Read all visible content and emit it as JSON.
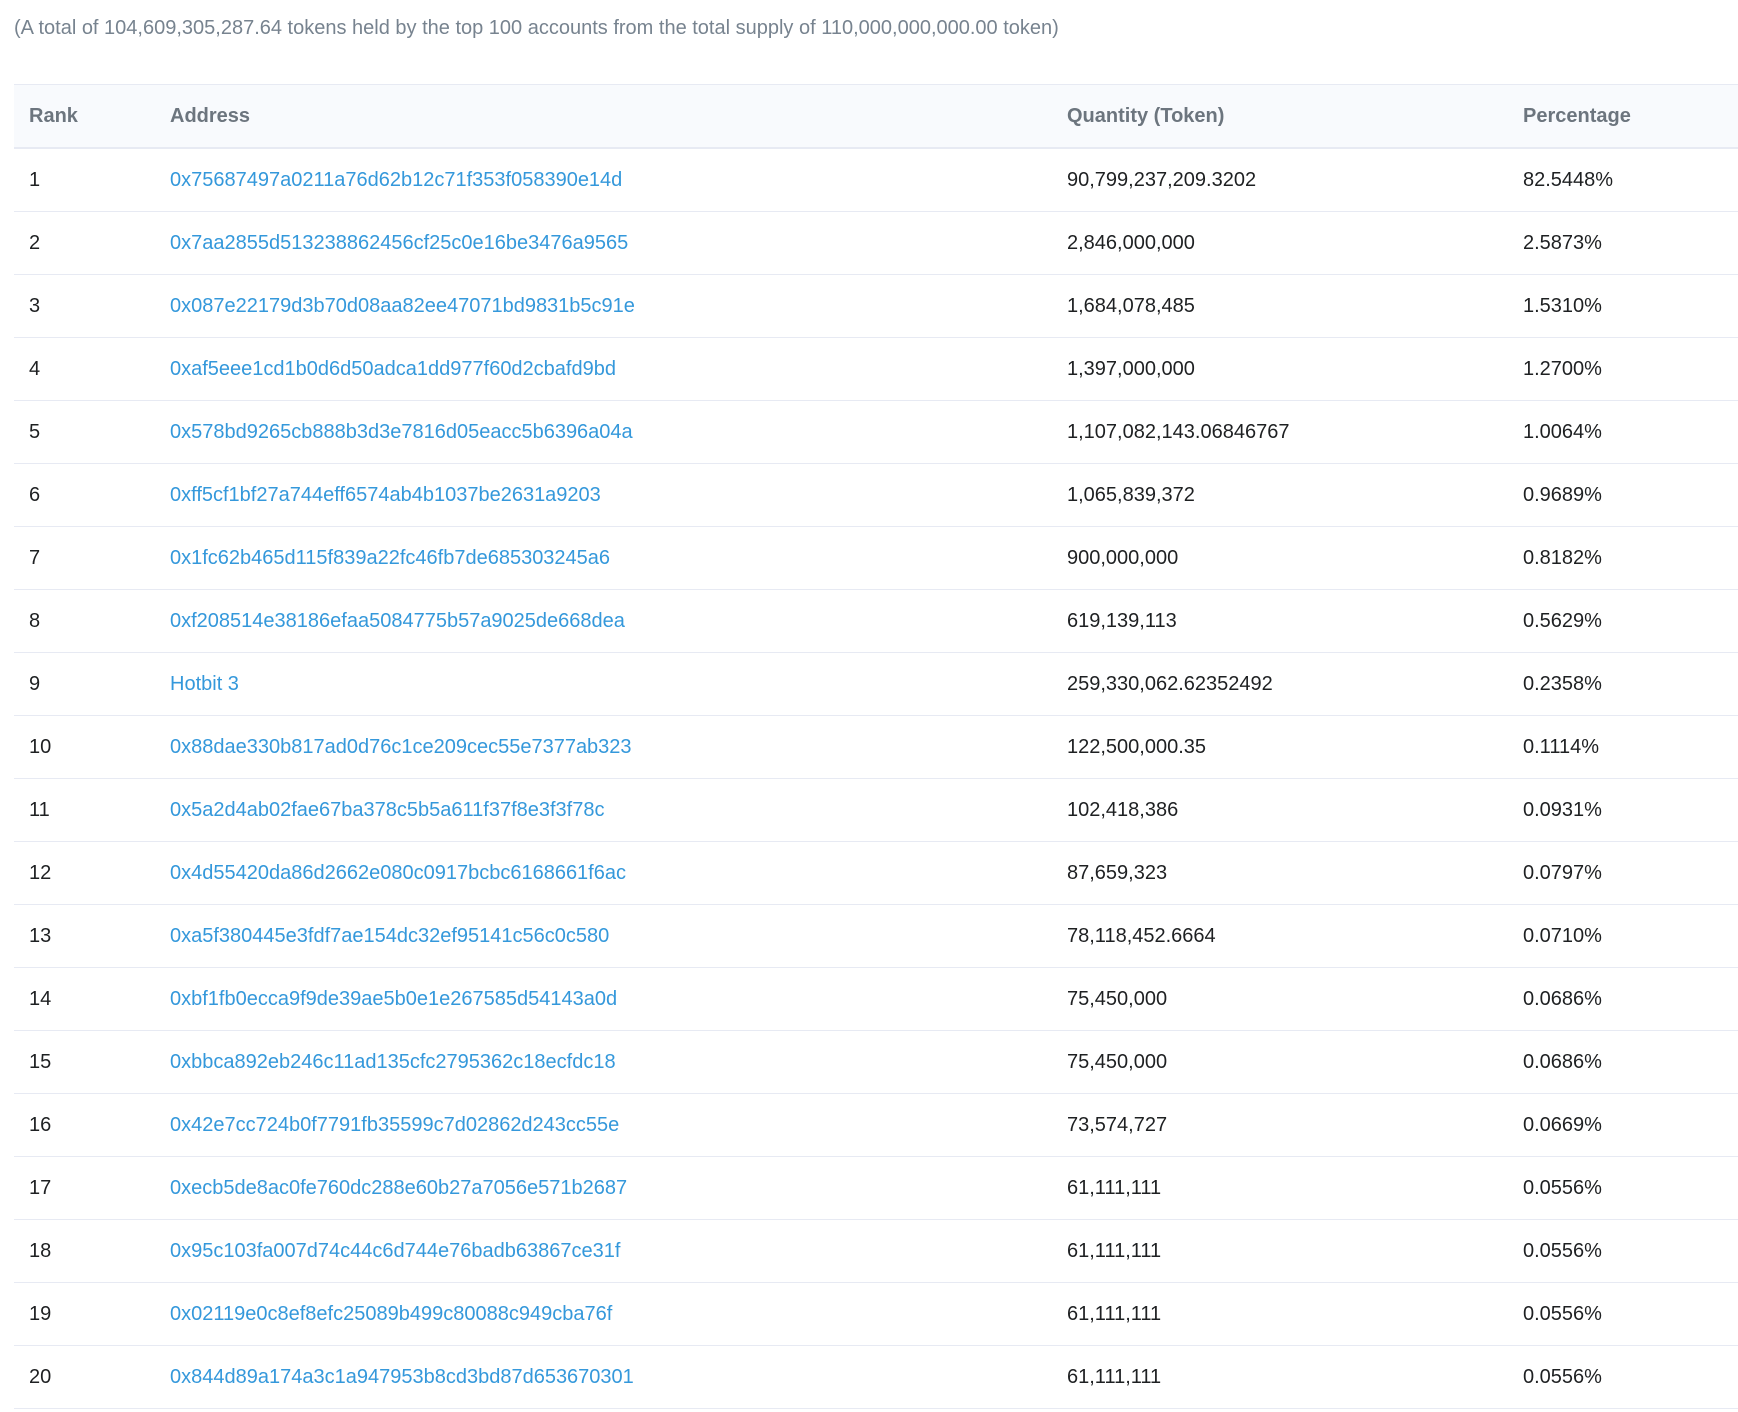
{
  "summary": "(A total of 104,609,305,287.64 tokens held by the top 100 accounts from the total supply of 110,000,000,000.00 token)",
  "table": {
    "headers": {
      "rank": "Rank",
      "address": "Address",
      "quantity": "Quantity (Token)",
      "percentage": "Percentage"
    },
    "rows": [
      {
        "rank": "1",
        "address": "0x75687497a0211a76d62b12c71f353f058390e14d",
        "quantity": "90,799,237,209.3202",
        "percentage": "82.5448%"
      },
      {
        "rank": "2",
        "address": "0x7aa2855d513238862456cf25c0e16be3476a9565",
        "quantity": "2,846,000,000",
        "percentage": "2.5873%"
      },
      {
        "rank": "3",
        "address": "0x087e22179d3b70d08aa82ee47071bd9831b5c91e",
        "quantity": "1,684,078,485",
        "percentage": "1.5310%"
      },
      {
        "rank": "4",
        "address": "0xaf5eee1cd1b0d6d50adca1dd977f60d2cbafd9bd",
        "quantity": "1,397,000,000",
        "percentage": "1.2700%"
      },
      {
        "rank": "5",
        "address": "0x578bd9265cb888b3d3e7816d05eacc5b6396a04a",
        "quantity": "1,107,082,143.06846767",
        "percentage": "1.0064%"
      },
      {
        "rank": "6",
        "address": "0xff5cf1bf27a744eff6574ab4b1037be2631a9203",
        "quantity": "1,065,839,372",
        "percentage": "0.9689%"
      },
      {
        "rank": "7",
        "address": "0x1fc62b465d115f839a22fc46fb7de685303245a6",
        "quantity": "900,000,000",
        "percentage": "0.8182%"
      },
      {
        "rank": "8",
        "address": "0xf208514e38186efaa5084775b57a9025de668dea",
        "quantity": "619,139,113",
        "percentage": "0.5629%"
      },
      {
        "rank": "9",
        "address": "Hotbit 3",
        "quantity": "259,330,062.62352492",
        "percentage": "0.2358%"
      },
      {
        "rank": "10",
        "address": "0x88dae330b817ad0d76c1ce209cec55e7377ab323",
        "quantity": "122,500,000.35",
        "percentage": "0.1114%"
      },
      {
        "rank": "11",
        "address": "0x5a2d4ab02fae67ba378c5b5a611f37f8e3f3f78c",
        "quantity": "102,418,386",
        "percentage": "0.0931%"
      },
      {
        "rank": "12",
        "address": "0x4d55420da86d2662e080c0917bcbc6168661f6ac",
        "quantity": "87,659,323",
        "percentage": "0.0797%"
      },
      {
        "rank": "13",
        "address": "0xa5f380445e3fdf7ae154dc32ef95141c56c0c580",
        "quantity": "78,118,452.6664",
        "percentage": "0.0710%"
      },
      {
        "rank": "14",
        "address": "0xbf1fb0ecca9f9de39ae5b0e1e267585d54143a0d",
        "quantity": "75,450,000",
        "percentage": "0.0686%"
      },
      {
        "rank": "15",
        "address": "0xbbca892eb246c11ad135cfc2795362c18ecfdc18",
        "quantity": "75,450,000",
        "percentage": "0.0686%"
      },
      {
        "rank": "16",
        "address": "0x42e7cc724b0f7791fb35599c7d02862d243cc55e",
        "quantity": "73,574,727",
        "percentage": "0.0669%"
      },
      {
        "rank": "17",
        "address": "0xecb5de8ac0fe760dc288e60b27a7056e571b2687",
        "quantity": "61,111,111",
        "percentage": "0.0556%"
      },
      {
        "rank": "18",
        "address": "0x95c103fa007d74c44c6d744e76badb63867ce31f",
        "quantity": "61,111,111",
        "percentage": "0.0556%"
      },
      {
        "rank": "19",
        "address": "0x02119e0c8ef8efc25089b499c80088c949cba76f",
        "quantity": "61,111,111",
        "percentage": "0.0556%"
      },
      {
        "rank": "20",
        "address": "0x844d89a174a3c1a947953b8cd3bd87d653670301",
        "quantity": "61,111,111",
        "percentage": "0.0556%"
      }
    ]
  },
  "colors": {
    "link": "#3498db",
    "muted_text": "#77838f",
    "header_bg": "#f8fafd",
    "border": "#e7eaf3"
  }
}
